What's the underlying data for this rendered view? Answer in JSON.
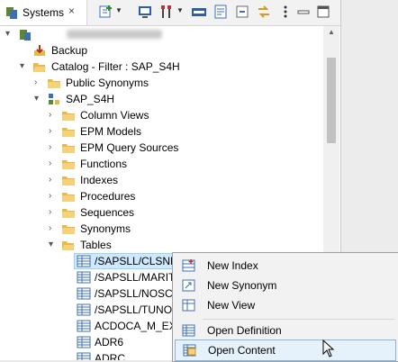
{
  "tabbar": {
    "tab_label": "Systems",
    "close_icon": "×"
  },
  "tree": {
    "system_label": "",
    "backup": "Backup",
    "catalog": "Catalog - Filter : SAP_S4H",
    "public_synonyms": "Public Synonyms",
    "schema": "SAP_S4H",
    "folders": [
      "Column Views",
      "EPM Models",
      "EPM Query Sources",
      "Functions",
      "Indexes",
      "Procedures",
      "Sequences",
      "Synonyms",
      "Tables"
    ],
    "tables": [
      "/SAPSLL/CLSNR",
      "/SAPSLL/MARIT",
      "/SAPSLL/NOSCA",
      "/SAPSLL/TUNO",
      "ACDOCA_M_EX",
      "ADR6",
      "ADRC"
    ]
  },
  "context_menu": {
    "items": [
      "New Index",
      "New Synonym",
      "New View",
      "Open Definition",
      "Open Content"
    ],
    "highlighted": "Open Content"
  },
  "colors": {
    "folder": "#e8b94a",
    "selection": "#cde8ff",
    "menu_highlight": "#e5f1fb"
  }
}
